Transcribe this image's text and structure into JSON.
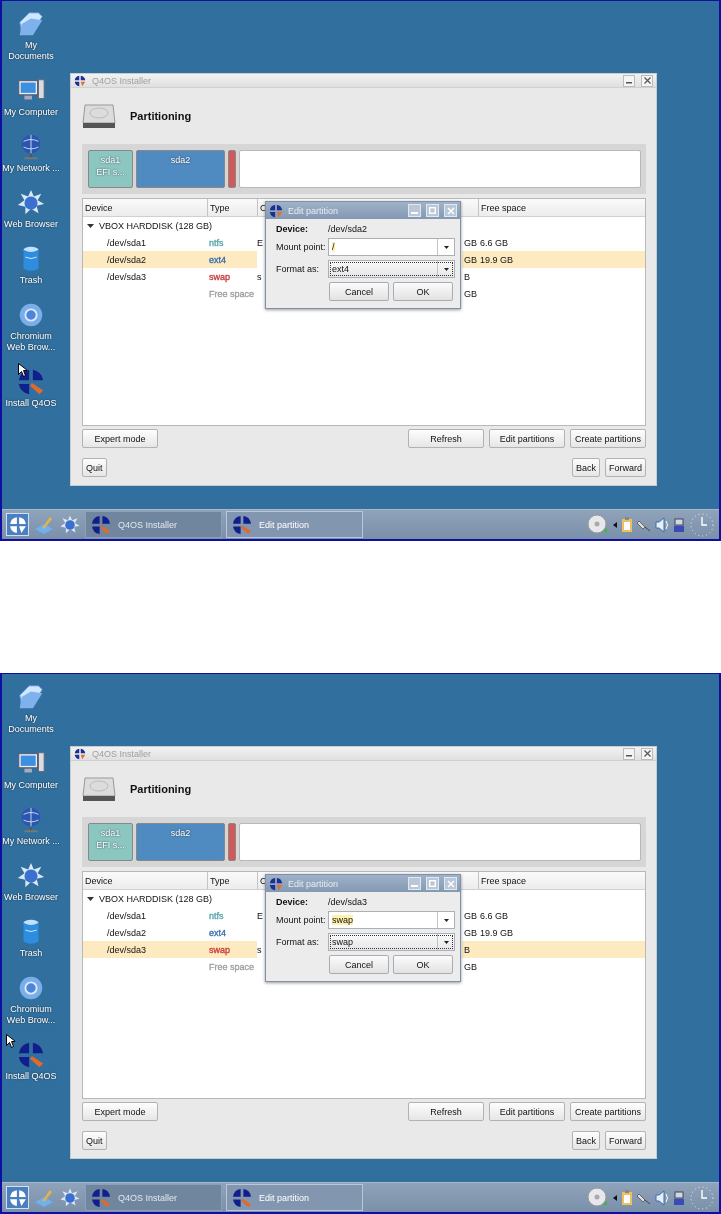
{
  "screenshots": [
    {
      "desktop_icons": [
        {
          "label": "My Documents",
          "kind": "documents"
        },
        {
          "label": "My Computer",
          "kind": "computer"
        },
        {
          "label": "My Network ...",
          "kind": "network"
        },
        {
          "label": "Web Browser",
          "kind": "browser"
        },
        {
          "label": "Trash",
          "kind": "trash"
        },
        {
          "label": "Chromium Web Brow...",
          "kind": "chromium"
        },
        {
          "label": "Install Q4OS",
          "kind": "installer"
        }
      ],
      "installer": {
        "title": "Q4OS Installer",
        "heading": "Partitioning",
        "partition_bar": [
          {
            "kind": "partition",
            "label": "sda1",
            "sublabel": "EFI s...",
            "color": "#8cc6c0"
          },
          {
            "kind": "partition",
            "label": "sda2",
            "color": "#4f8ac0"
          },
          {
            "kind": "partition",
            "color": "#d05a5a"
          },
          {
            "kind": "free"
          }
        ],
        "table": {
          "columns": [
            "Device",
            "Type",
            "C",
            "Free space"
          ],
          "disk": {
            "label": "VBOX HARDDISK (128 GB)",
            "expanded": true
          },
          "rows": [
            {
              "device": "/dev/sda1",
              "type": "ntfs",
              "color": "#5aa6a8",
              "column_3": "E",
              "column_4": "GB",
              "free_space": "6.6 GB",
              "selected": false
            },
            {
              "device": "/dev/sda2",
              "type": "ext4",
              "color": "#3a6fa8",
              "column_4": "GB",
              "free_space": "19.9 GB",
              "selected": true
            },
            {
              "device": "/dev/sda3",
              "type": "swap",
              "color": "#c84040",
              "column_3": "s",
              "column_4": "B",
              "selected": false
            },
            {
              "type": "Free space",
              "color": "#a0a0a0",
              "column_4": "GB",
              "selected": false
            }
          ]
        },
        "left_buttons": [
          "Expert mode"
        ],
        "right_buttons": [
          "Refresh",
          "Edit partitions",
          "Create partitions"
        ],
        "quit_button": "Quit",
        "nav_buttons": [
          "Back",
          "Forward"
        ]
      },
      "dialog": {
        "title": "Edit partition",
        "device_label": "Device:",
        "device": "/dev/sda2",
        "mount_label": "Mount point:",
        "mount_value": "/",
        "format_label": "Format as:",
        "format_value": "ext4",
        "buttons": [
          "Cancel",
          "OK"
        ]
      },
      "taskbar": {
        "tasks": [
          {
            "label": "Q4OS Installer",
            "selected": false
          },
          {
            "label": "Edit partition",
            "selected": true
          }
        ]
      }
    },
    {
      "desktop_icons": [
        {
          "label": "My Documents",
          "kind": "documents"
        },
        {
          "label": "My Computer",
          "kind": "computer"
        },
        {
          "label": "My Network ...",
          "kind": "network"
        },
        {
          "label": "Web Browser",
          "kind": "browser"
        },
        {
          "label": "Trash",
          "kind": "trash"
        },
        {
          "label": "Chromium Web Brow...",
          "kind": "chromium"
        },
        {
          "label": "Install Q4OS",
          "kind": "installer"
        }
      ],
      "installer": {
        "title": "Q4OS Installer",
        "heading": "Partitioning",
        "partition_bar": [
          {
            "kind": "partition",
            "label": "sda1",
            "sublabel": "EFI s...",
            "color": "#8cc6c0"
          },
          {
            "kind": "partition",
            "label": "sda2",
            "color": "#4f8ac0"
          },
          {
            "kind": "partition",
            "color": "#d05a5a"
          },
          {
            "kind": "free"
          }
        ],
        "table": {
          "columns": [
            "Device",
            "Type",
            "C",
            "Free space"
          ],
          "disk": {
            "label": "VBOX HARDDISK (128 GB)",
            "expanded": true
          },
          "rows": [
            {
              "device": "/dev/sda1",
              "type": "ntfs",
              "color": "#5aa6a8",
              "column_3": "E",
              "column_4": "GB",
              "free_space": "6.6 GB",
              "selected": false
            },
            {
              "device": "/dev/sda2",
              "type": "ext4",
              "color": "#3a6fa8",
              "column_4": "GB",
              "free_space": "19.9 GB",
              "selected": false
            },
            {
              "device": "/dev/sda3",
              "type": "swap",
              "color": "#c84040",
              "column_3": "s",
              "column_4": "B",
              "selected": true
            },
            {
              "type": "Free space",
              "color": "#a0a0a0",
              "column_4": "GB",
              "selected": false
            }
          ]
        },
        "left_buttons": [
          "Expert mode"
        ],
        "right_buttons": [
          "Refresh",
          "Edit partitions",
          "Create partitions"
        ],
        "quit_button": "Quit",
        "nav_buttons": [
          "Back",
          "Forward"
        ]
      },
      "dialog": {
        "title": "Edit partition",
        "device_label": "Device:",
        "device": "/dev/sda3",
        "mount_label": "Mount point:",
        "mount_value": "swap",
        "format_label": "Format as:",
        "format_value": "swap",
        "buttons": [
          "Cancel",
          "OK"
        ]
      },
      "taskbar": {
        "tasks": [
          {
            "label": "Q4OS Installer",
            "selected": false
          },
          {
            "label": "Edit partition",
            "selected": true
          }
        ]
      }
    }
  ]
}
